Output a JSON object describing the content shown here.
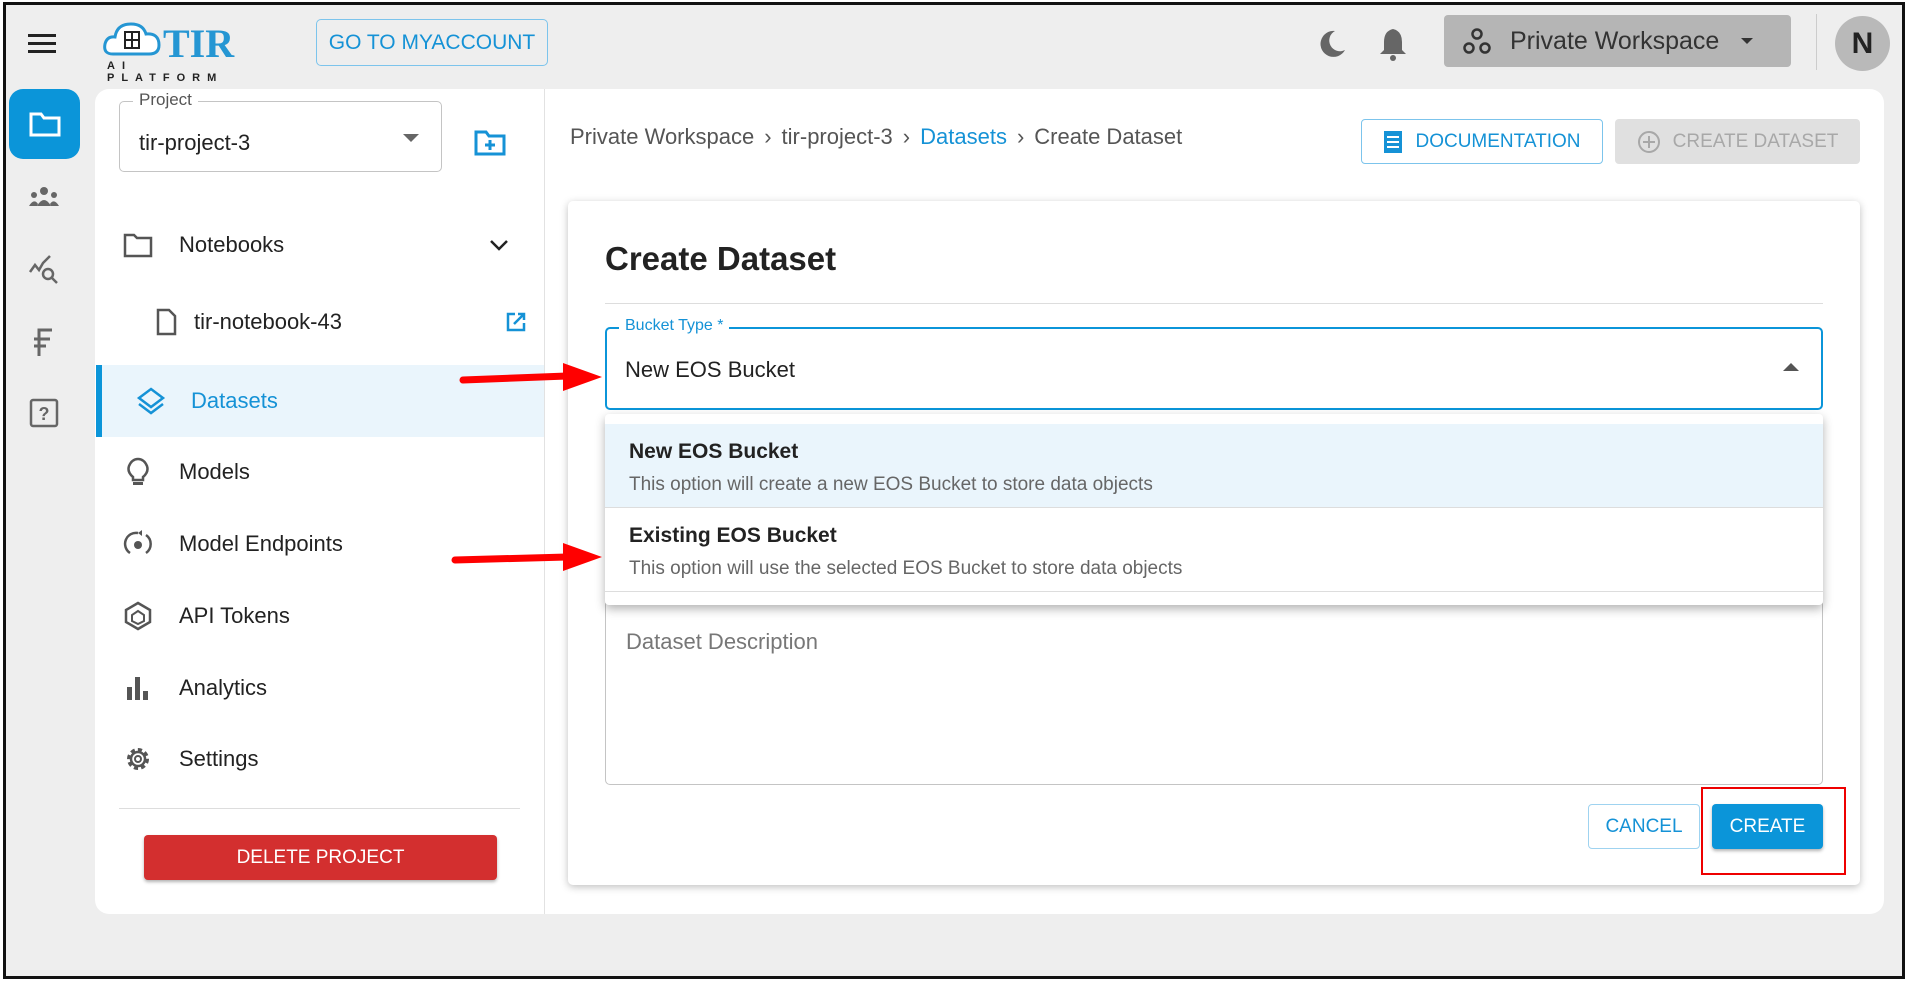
{
  "header": {
    "logo_text": "TIR",
    "logo_subtext": "AI PLATFORM",
    "myaccount_label": "GO TO MYACCOUNT",
    "workspace_label": "Private Workspace",
    "avatar_initial": "N"
  },
  "sidebar": {
    "project_label": "Project",
    "project_value": "tir-project-3",
    "items": [
      {
        "label": "Notebooks",
        "icon": "folder-icon"
      },
      {
        "label": "tir-notebook-43",
        "icon": "file-icon"
      },
      {
        "label": "Datasets",
        "icon": "layers-icon",
        "active": true
      },
      {
        "label": "Models",
        "icon": "lightbulb-icon"
      },
      {
        "label": "Model Endpoints",
        "icon": "endpoint-icon"
      },
      {
        "label": "API Tokens",
        "icon": "hexagon-icon"
      },
      {
        "label": "Analytics",
        "icon": "bar-chart-icon"
      },
      {
        "label": "Settings",
        "icon": "gear-icon"
      }
    ],
    "delete_label": "DELETE PROJECT"
  },
  "breadcrumb": [
    "Private Workspace",
    "tir-project-3",
    "Datasets",
    "Create Dataset"
  ],
  "toolbar": {
    "documentation_label": "DOCUMENTATION",
    "create_dataset_label": "CREATE DATASET"
  },
  "dialog": {
    "title": "Create Dataset",
    "bucket_type_label": "Bucket Type *",
    "bucket_type_value": "New EOS Bucket",
    "options": [
      {
        "title": "New EOS Bucket",
        "description": "This option will create a new EOS Bucket to store data objects"
      },
      {
        "title": "Existing EOS Bucket",
        "description": "This option will use the selected EOS Bucket to store data objects"
      }
    ],
    "description_placeholder": "Dataset Description",
    "cancel_label": "CANCEL",
    "create_label": "CREATE"
  },
  "colors": {
    "accent": "#0b95d9",
    "danger": "#d32f2f",
    "annotation": "#ff0000"
  }
}
